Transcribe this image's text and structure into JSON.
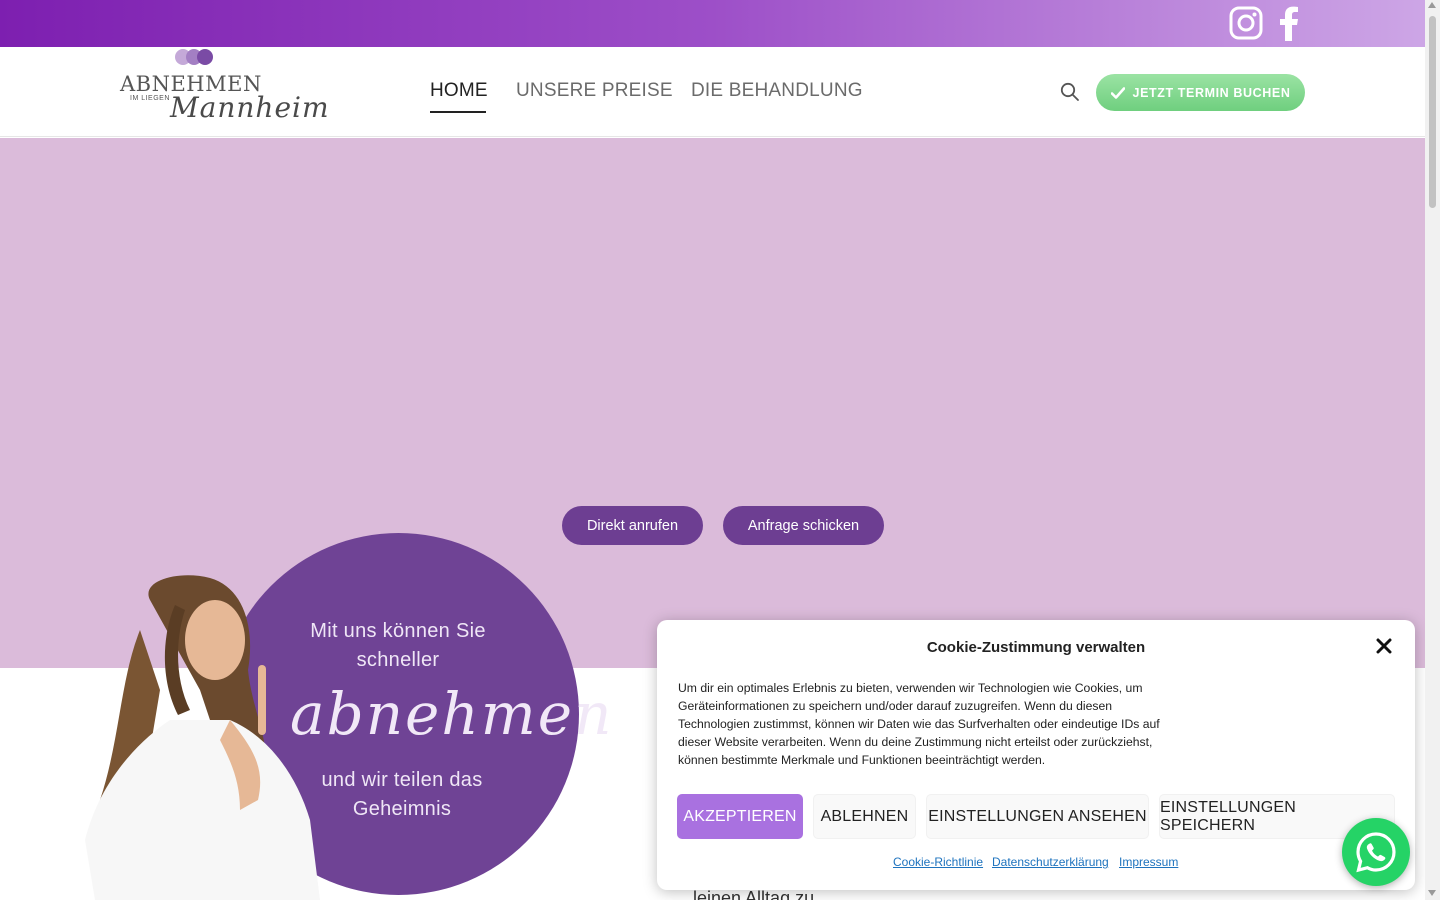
{
  "social": {
    "instagram_icon": "instagram-icon",
    "facebook_icon": "facebook-icon"
  },
  "logo": {
    "title": "ABNEHMEN",
    "subtitle": "IM LIEGEN",
    "script": "Mannheim"
  },
  "nav": {
    "items": [
      {
        "label": "HOME"
      },
      {
        "label": "UNSERE PREISE"
      },
      {
        "label": "DIE BEHANDLUNG"
      }
    ],
    "active": "HOME",
    "search_icon": "search-icon"
  },
  "cta": {
    "label": "JETZT TERMIN BUCHEN",
    "icon": "check-icon"
  },
  "hero": {
    "buttons": [
      {
        "label": "Direkt anrufen"
      },
      {
        "label": "Anfrage schicken"
      }
    ]
  },
  "promo": {
    "line1": "Mit uns können Sie",
    "line2": "schneller",
    "script": "abnehmen",
    "line3": "und wir teilen das",
    "line4": "Geheimnis"
  },
  "behind_text": "...leinen Alltag zu...",
  "cookie": {
    "title": "Cookie-Zustimmung verwalten",
    "body": "Um dir ein optimales Erlebnis zu bieten, verwenden wir Technologien wie Cookies, um Geräteinformationen zu speichern und/oder darauf zuzugreifen. Wenn du diesen Technologien zustimmst, können wir Daten wie das Surfverhalten oder eindeutige IDs auf dieser Website verarbeiten. Wenn du deine Zustimmung nicht erteilst oder zurückziehst, können bestimmte Merkmale und Funktionen beeinträchtigt werden.",
    "buttons": {
      "accept": "AKZEPTIEREN",
      "deny": "ABLEHNEN",
      "view": "EINSTELLUNGEN ANSEHEN",
      "save": "EINSTELLUNGEN SPEICHERN"
    },
    "links": {
      "policy": "Cookie-Richtlinie",
      "privacy": "Datenschutzerklärung",
      "imprint": "Impressum"
    }
  },
  "colors": {
    "topbar_start": "#7d1fb0",
    "hero_bg": "#dbbbda",
    "pill": "#6d3e92",
    "circle": "#6f4395",
    "accept": "#a971e0",
    "cta": "#6fcf7f",
    "whatsapp": "#25d366"
  }
}
